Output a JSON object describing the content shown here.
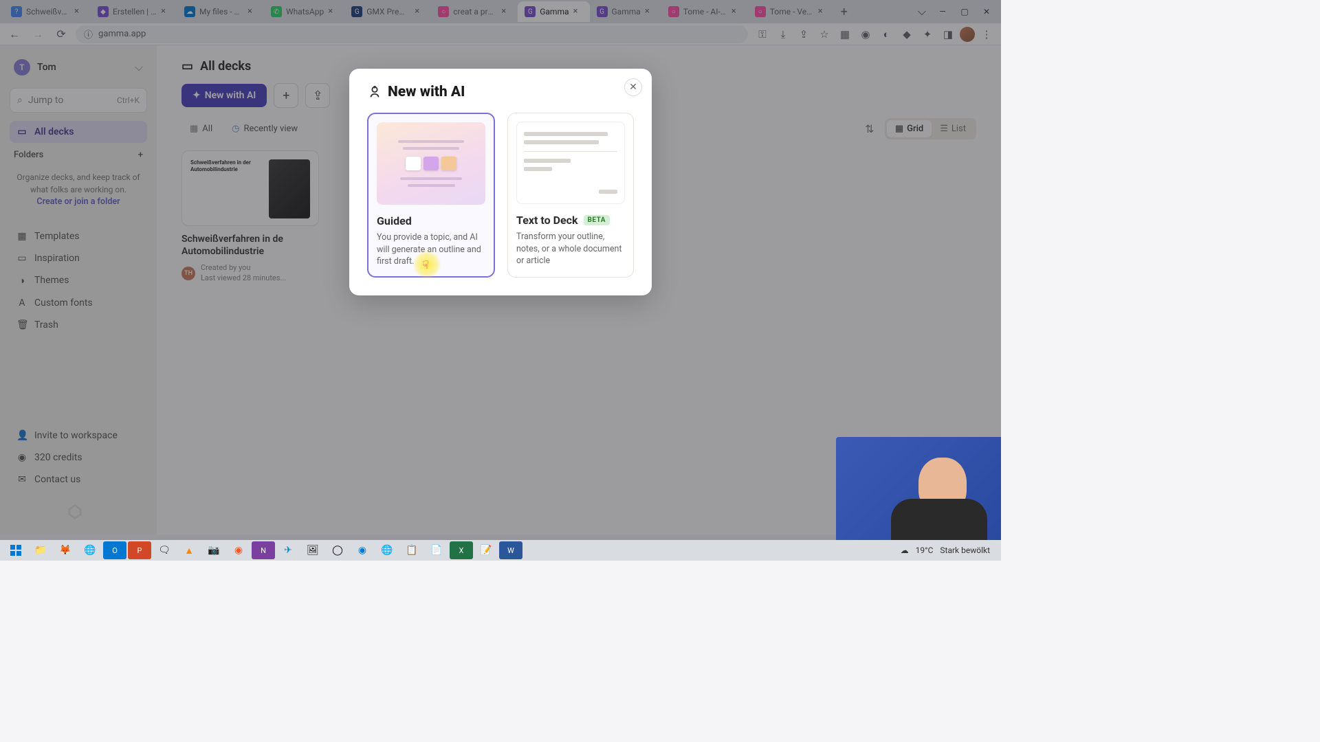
{
  "tabs": [
    {
      "label": "Schweißverfahren",
      "favicon_bg": "#4285f4",
      "favicon_text": "?"
    },
    {
      "label": "Erstellen | Micros",
      "favicon_bg": "#7b4dd6",
      "favicon_text": "◆"
    },
    {
      "label": "My files - OneDri",
      "favicon_bg": "#0078d4",
      "favicon_text": "☁"
    },
    {
      "label": "WhatsApp",
      "favicon_bg": "#25d366",
      "favicon_text": "✆"
    },
    {
      "label": "GMX Premium - E",
      "favicon_bg": "#1a3d7c",
      "favicon_text": "G"
    },
    {
      "label": "creat a presentati",
      "favicon_bg": "#ff4da6",
      "favicon_text": "○"
    },
    {
      "label": "Gamma",
      "favicon_bg": "#7b4dd6",
      "favicon_text": "G",
      "active": true
    },
    {
      "label": "Gamma",
      "favicon_bg": "#7b4dd6",
      "favicon_text": "G"
    },
    {
      "label": "Tome - AI-powere",
      "favicon_bg": "#ff4da6",
      "favicon_text": "○"
    },
    {
      "label": "Tome - Verify",
      "favicon_bg": "#ff4da6",
      "favicon_text": "○"
    }
  ],
  "url": "gamma.app",
  "sidebar": {
    "user_initial": "T",
    "user_name": "Tom",
    "search_placeholder": "Jump to",
    "search_kbd": "Ctrl+K",
    "all_decks": "All decks",
    "folders_label": "Folders",
    "folders_info": "Organize decks, and keep track of what folks are working on.",
    "folders_link": "Create or join a folder",
    "templates": "Templates",
    "inspiration": "Inspiration",
    "themes": "Themes",
    "custom_fonts": "Custom fonts",
    "trash": "Trash",
    "invite": "Invite to workspace",
    "credits": "320 credits",
    "contact": "Contact us"
  },
  "main": {
    "title": "All decks",
    "new_ai": "New with AI",
    "filter_all": "All",
    "filter_recent": "Recently view",
    "view_grid": "Grid",
    "view_list": "List",
    "deck": {
      "thumb_title": "Schweißverfahren in der Automobilindustrie",
      "title": "Schweißverfahren in de Automobilindustrie",
      "author_initials": "TH",
      "created": "Created by you",
      "viewed": "Last viewed 28 minutes..."
    }
  },
  "modal": {
    "title": "New with AI",
    "guided_title": "Guided",
    "guided_desc": "You provide a topic, and AI will generate an outline and first draft.",
    "text_title": "Text to Deck",
    "text_badge": "BETA",
    "text_desc": "Transform your outline, notes, or a whole document or article"
  },
  "taskbar": {
    "weather_temp": "19°C",
    "weather_desc": "Stark bewölkt"
  }
}
